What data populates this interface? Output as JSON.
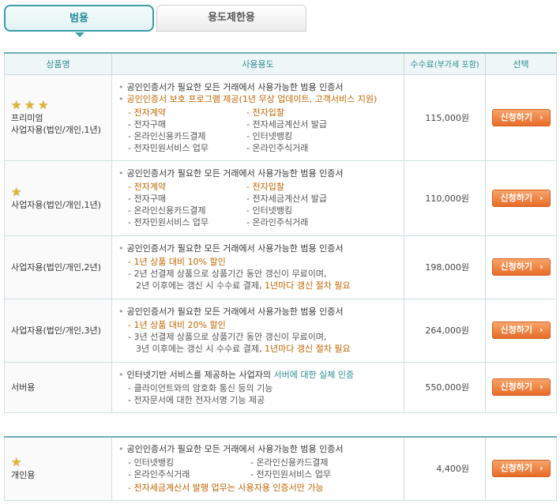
{
  "tabs": [
    {
      "label": "범용",
      "active": true
    },
    {
      "label": "용도제한용",
      "active": false
    }
  ],
  "table_headers": {
    "name": "상품명",
    "usage": "사용용도",
    "fee": "수수료",
    "fee_note": "(부가세 포함)",
    "select": "선택"
  },
  "apply_label": "신청하기",
  "chevron": "›",
  "rows": [
    {
      "stars": 3,
      "name_lines": [
        "프리미엄",
        "사업자용(법인/개인,1년)"
      ],
      "main": "공인인증서가 필요한 모든 거래에서 사용가능한 범용 인증서",
      "main2": "공인인증서 보호 프로그램 제공(1년 무상 업데이트, 고객서비스 지원)",
      "items": [
        [
          "전자계약",
          "전자입찰"
        ],
        [
          "전자구매",
          "전자세금계산서 발급"
        ],
        [
          "온라인신용카드결제",
          "인터넷뱅킹"
        ],
        [
          "전자민원서비스 업무",
          "온라인주식거래"
        ]
      ],
      "price": "115,000원"
    },
    {
      "stars": 1,
      "name_lines": [
        "사업자용(법인/개인,1년)"
      ],
      "main": "공인인증서가 필요한 모든 거래에서 사용가능한 범용 인증서",
      "items": [
        [
          "전자계약",
          "전자입찰"
        ],
        [
          "전자구매",
          "전자세금계산서 발급"
        ],
        [
          "온라인신용카드결제",
          "인터넷뱅킹"
        ],
        [
          "전자민원서비스 업무",
          "온라인주식거래"
        ]
      ],
      "price": "110,000원"
    },
    {
      "stars": 0,
      "name_lines": [
        "사업자용(법인/개인,2년)"
      ],
      "main": "공인인증서가 필요한 모든 거래에서 사용가능한 범용 인증서",
      "note1": "- 1년 상품 대비 10% 할인",
      "note2": "- 2년 선결제 상품으로 상품기간 동안 갱신이 무료이며,",
      "note3a": "2년 이후에는 갱신 시 수수료 결제, ",
      "note3b": "1년마다 갱신 절차 필요",
      "price": "198,000원"
    },
    {
      "stars": 0,
      "name_lines": [
        "사업자용(법인/개인,3년)"
      ],
      "main": "공인인증서가 필요한 모든 거래에서 사용가능한 범용 인증서",
      "note1": "- 1년 상품 대비 20% 할인",
      "note2": "- 3년 선결제 상품으로 상품기간 동안 갱신이 무료이며,",
      "note3a": "3년 이후에는 갱신 시 수수료 결제, ",
      "note3b": "1년마다 갱신 절차 필요",
      "price": "264,000원"
    },
    {
      "stars": 0,
      "name_lines": [
        "서버용"
      ],
      "main_a": "인터넷기반 서비스를 제공하는 사업자의 ",
      "main_b": "서버에 대한 실체 인증",
      "note1": "- 클라이언트와의 암호화 통신 등의 기능",
      "note2": "- 전자문서에 대한 전자서명 기능 제공",
      "price": "550,000원"
    }
  ],
  "personal": {
    "stars": 1,
    "name": "개인용",
    "main": "공인인증서가 필요한 모든 거래에서 사용가능한 범용 인증서",
    "items": [
      [
        "인터넷뱅킹",
        "온라인신용카드결제"
      ],
      [
        "온라인주식거래",
        "전자민원서비스 업무"
      ]
    ],
    "note": "- 전자세금계산서 발행 업무는 사용자용 인증서만 가능",
    "price": "4,400원"
  },
  "colors": {
    "accent": "#2a8b93",
    "orange": "#c16500",
    "button": "#e86c28",
    "star": "#e8b321"
  }
}
